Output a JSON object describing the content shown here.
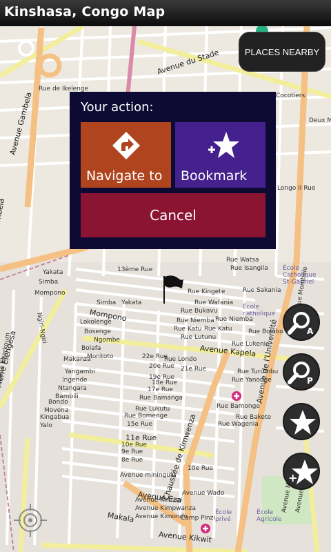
{
  "app": {
    "title": "Kinshasa, Congo Map"
  },
  "places_button": {
    "label": "PLACES NEARBY"
  },
  "dialog": {
    "heading": "Your action:",
    "navigate_label": "Navigate to",
    "bookmark_label": "Bookmark",
    "cancel_label": "Cancel"
  },
  "fabs": [
    {
      "icon": "search-address-icon",
      "badge": "A"
    },
    {
      "icon": "search-poi-icon",
      "badge": "P"
    },
    {
      "icon": "star-icon",
      "badge": ""
    },
    {
      "icon": "add-bookmark-icon",
      "badge": "+"
    }
  ],
  "map_labels": {
    "av_du_stade": "Avenue du Stade",
    "rue_ikelenge": "Rue de Ikelenge",
    "av_gambela": "Avenue Gambela",
    "cocotiers": "Cocotiers",
    "deux_mass": "Deux Mass",
    "longo": "Longo II Rue",
    "gambela": "Gambela",
    "yakata": "Yakata",
    "simba": "Simba",
    "mompono": "Mompono",
    "ngiri": "Ngiri-Ngiri",
    "rue_13": "13ème Rue",
    "rue_kingete": "Rue Kingete",
    "rue_wafania": "Rue Wafania",
    "rue_bukavu": "Rue Bukavu",
    "rue_niemba": "Rue Niemba",
    "rue_katu": "Rue Katu",
    "rue_lutunu": "Rue Lutunu",
    "rue_watsa": "Rue Watsa",
    "rue_isangila": "Rue Isangila",
    "rue_sakania": "Rue Sakania",
    "ecole_catholique": "École catholique",
    "ecole_st_gabriel": "École Catholique St-Gabriel",
    "rue_bolobo": "Rue Bolobo",
    "rue_lukenie": "Rue Lukenie",
    "av_kapela": "Avenue Kapela",
    "av_universite": "Avenue de l'Université",
    "av_mombele": "Avenue Mombele",
    "av_kharkoum": "Avenue Kharkoum",
    "lokolenge": "Lokolenge",
    "bosenge": "Bosenge",
    "ngombe": "Ngombe",
    "bolafa": "Bolafa",
    "monkoto": "Monkoto",
    "makanza": "Makanza",
    "yangambi": "Yangambi",
    "ingende": "Ingende",
    "ntangara": "Ntangara",
    "bambili": "Bambili",
    "bondo": "Bondo",
    "movena": "Movena",
    "kingabua": "Kingabua",
    "yalo": "Yalo",
    "av_pierre": "Avenue Pierre Elengesa",
    "rue_22": "22e Rue",
    "rue_londo": "Rue Londo",
    "rue_20": "20e Rue",
    "rue_21": "21e Rue",
    "rue_19": "19e Rue",
    "rue_18": "18e Rue",
    "rue_17": "17e Rue",
    "rue_bamanga": "Rue Bamanga",
    "rue_lukutu": "Rue Lukutu",
    "rue_bomenge": "Rue Bomenge",
    "rue_15": "15e Rue",
    "rue_11": "11e Rue",
    "rue_10": "10e Rue",
    "rue_9": "9e Rue",
    "rue_8": "8e Rue",
    "rue_turumbu": "Rue Turumbu",
    "rue_yanonge": "Rue Yanonge",
    "rue_bamonge": "Rue Bamonge",
    "rue_bakete": "Rue Bakete",
    "rue_wagenia": "Rue Wagenia",
    "chaussee": "Chaussée de Kimwenza",
    "av_miningulu": "Avenue miningulu",
    "av_eza": "Avenue Eza",
    "av_kinzuzi": "Avenue Kinzuzi",
    "av_kimpwanza": "Avenue Kimpwanza",
    "av_kimondo": "Avenue Kimondo",
    "av_wado": "Avenue Wado",
    "rue_11b": "11e Rue",
    "rue_10b": "10e Rue",
    "makala": "Makala",
    "camp_pinzi": "Camp Pinzi",
    "ecole_prive": "École privé",
    "ecole_agricole": "École Agricole",
    "av_kikwit": "Avenue Kikwit",
    "av_kiwamb": "Avenue Kiwamb",
    "av_mombele2": "Avenue Mombele"
  },
  "colors": {
    "navigate": "#b0441e",
    "bookmark": "#45218e",
    "cancel": "#8c1433",
    "dialog_bg": "#0d0a33",
    "major_road": "#f4c083",
    "minor_road": "#f7f4a6"
  }
}
